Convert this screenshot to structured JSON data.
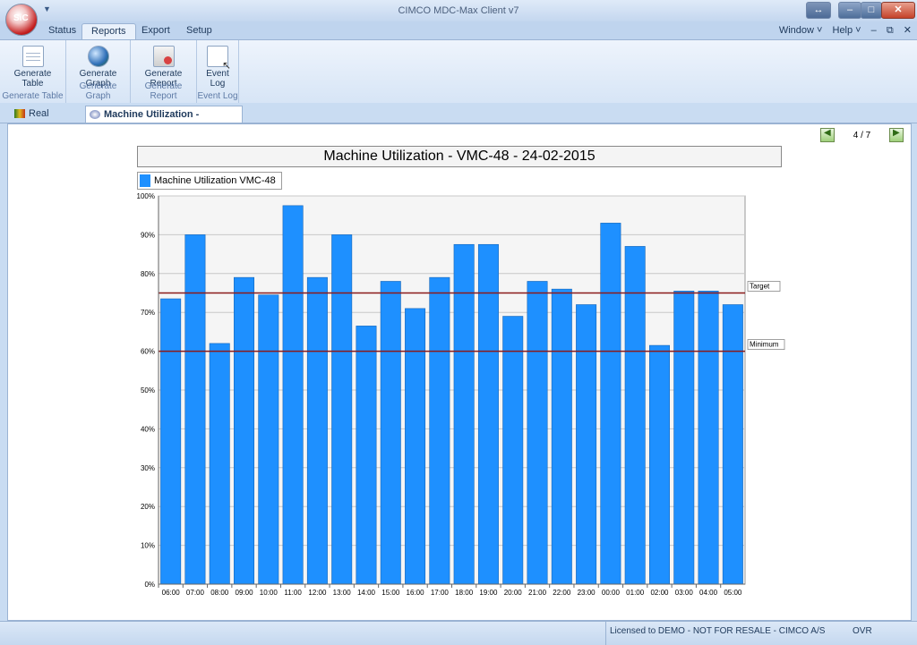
{
  "window": {
    "title": "CIMCO MDC-Max Client v7"
  },
  "app_orb_text": "SiC",
  "ribbon_tabs": [
    "Status",
    "Reports",
    "Export",
    "Setup"
  ],
  "right_menus": {
    "window": "Window ˅",
    "help": "Help ˅"
  },
  "ribbon_groups": [
    {
      "label_line1": "Generate",
      "label_line2": "Table",
      "group": "Generate Table",
      "icon": "table-icon"
    },
    {
      "label_line1": "Generate",
      "label_line2": "Graph",
      "group": "Generate Graph",
      "icon": "globe-icon"
    },
    {
      "label_line1": "Generate",
      "label_line2": "Report",
      "group": "Generate Report",
      "icon": "report-icon"
    },
    {
      "label_line1": "Event",
      "label_line2": "Log",
      "group": "Event Log",
      "icon": "log-icon"
    }
  ],
  "doc_tabs": [
    {
      "label": "Real Time"
    },
    {
      "label": "Machine Utilization  -  VMC-..."
    }
  ],
  "pager": {
    "text": "4 / 7"
  },
  "status": {
    "license": "Licensed to DEMO - NOT FOR RESALE - CIMCO A/S",
    "mode": "OVR"
  },
  "colors": {
    "bar": "#1e90ff",
    "reference_line": "#8b1a1a",
    "ribbon": "#d7e5f6"
  },
  "chart_data": {
    "type": "bar",
    "title": "Machine Utilization  -  VMC-48  -  24-02-2015",
    "series": [
      {
        "name": "Machine Utilization VMC-48"
      }
    ],
    "categories": [
      "06:00",
      "07:00",
      "08:00",
      "09:00",
      "10:00",
      "11:00",
      "12:00",
      "13:00",
      "14:00",
      "15:00",
      "16:00",
      "17:00",
      "18:00",
      "19:00",
      "20:00",
      "21:00",
      "22:00",
      "23:00",
      "00:00",
      "01:00",
      "02:00",
      "03:00",
      "04:00",
      "05:00"
    ],
    "values": [
      73.5,
      90,
      62,
      79,
      74.5,
      97.5,
      79,
      90,
      66.5,
      78,
      71,
      79,
      87.5,
      87.5,
      69,
      78,
      76,
      72,
      93,
      87,
      61.5,
      75.5,
      75.5,
      72
    ],
    "ylim": [
      0,
      100
    ],
    "yticks": [
      "0%",
      "10%",
      "20%",
      "30%",
      "40%",
      "50%",
      "60%",
      "70%",
      "80%",
      "90%",
      "100%"
    ],
    "reference_lines": [
      {
        "label": "Target",
        "value": 75
      },
      {
        "label": "Minimum",
        "value": 60
      }
    ],
    "grid": true,
    "legend_position": "top-left"
  }
}
